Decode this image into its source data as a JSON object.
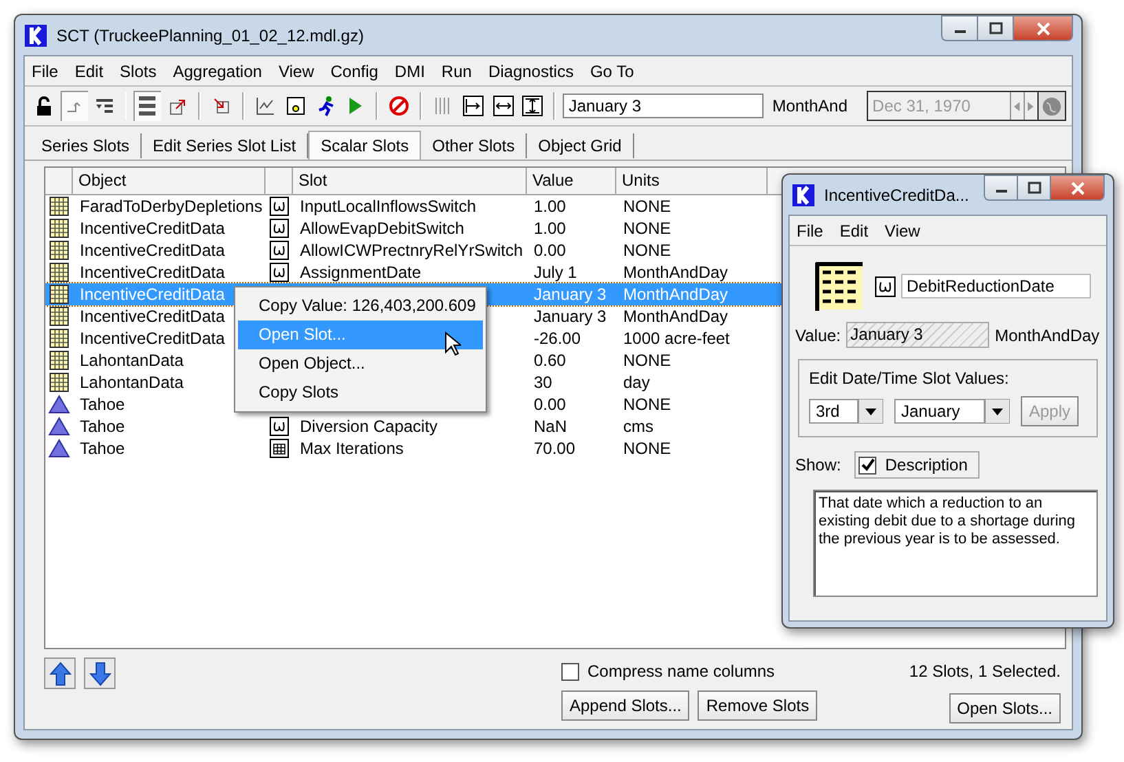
{
  "window": {
    "title": "SCT  (TruckeePlanning_01_02_12.mdl.gz)"
  },
  "menu": [
    "File",
    "Edit",
    "Slots",
    "Aggregation",
    "View",
    "Config",
    "DMI",
    "Run",
    "Diagnostics",
    "Go To"
  ],
  "toolbar": {
    "value": "January 3",
    "units": "MonthAnd",
    "date": {
      "value": "Dec 31, 1970",
      "disabled": true
    }
  },
  "tabs": [
    {
      "label": "Series Slots",
      "selected": false
    },
    {
      "label": "Edit Series Slot List",
      "selected": false
    },
    {
      "label": "Scalar Slots",
      "selected": true
    },
    {
      "label": "Other Slots",
      "selected": false
    },
    {
      "label": "Object Grid",
      "selected": false
    }
  ],
  "table": {
    "columns": [
      "Object",
      "Slot",
      "Value",
      "Units"
    ],
    "rows": [
      {
        "object": {
          "kind": "data",
          "name": "FaradToDerbyDepletions"
        },
        "slot": {
          "kind": "scalar",
          "name": "InputLocalInflowsSwitch"
        },
        "value": "1.00",
        "units": "NONE",
        "selected": false
      },
      {
        "object": {
          "kind": "data",
          "name": "IncentiveCreditData"
        },
        "slot": {
          "kind": "scalar",
          "name": "AllowEvapDebitSwitch"
        },
        "value": "1.00",
        "units": "NONE",
        "selected": false
      },
      {
        "object": {
          "kind": "data",
          "name": "IncentiveCreditData"
        },
        "slot": {
          "kind": "scalar",
          "name": "AllowICWPrectnryRelYrSwitch"
        },
        "value": "0.00",
        "units": "NONE",
        "selected": false
      },
      {
        "object": {
          "kind": "data",
          "name": "IncentiveCreditData"
        },
        "slot": {
          "kind": "scalar",
          "name": "AssignmentDate"
        },
        "value": "July 1",
        "units": "MonthAndDay",
        "selected": false
      },
      {
        "object": {
          "kind": "data",
          "name": "IncentiveCreditData"
        },
        "value": "January 3",
        "units": "MonthAndDay",
        "selected": true
      },
      {
        "object": {
          "kind": "data",
          "name": "IncentiveCreditData"
        },
        "value": "January 3",
        "units": "MonthAndDay",
        "selected": false
      },
      {
        "object": {
          "kind": "data",
          "name": "IncentiveCreditData"
        },
        "value": "-26.00",
        "units": "1000 acre-feet",
        "selected": false
      },
      {
        "object": {
          "kind": "data",
          "name": "LahontanData"
        },
        "value": "0.60",
        "units": "NONE",
        "selected": false
      },
      {
        "object": {
          "kind": "data",
          "name": "LahontanData"
        },
        "value": "30",
        "units": "day",
        "selected": false
      },
      {
        "object": {
          "kind": "reservoir",
          "name": "Tahoe"
        },
        "value": "0.00",
        "units": "NONE",
        "selected": false
      },
      {
        "object": {
          "kind": "reservoir",
          "name": "Tahoe"
        },
        "slot": {
          "kind": "scalar",
          "name": "Diversion Capacity"
        },
        "value": "NaN",
        "units": "cms",
        "selected": false
      },
      {
        "object": {
          "kind": "reservoir",
          "name": "Tahoe"
        },
        "slot": {
          "kind": "table",
          "name": "Max Iterations"
        },
        "value": "70.00",
        "units": "NONE",
        "selected": false
      }
    ]
  },
  "context_menu": [
    {
      "label": "Copy Value: 126,403,200.609",
      "selected": false
    },
    {
      "label": "Open Slot...",
      "selected": true
    },
    {
      "label": "Open Object...",
      "selected": false
    },
    {
      "label": "Copy Slots",
      "selected": false
    }
  ],
  "footer": {
    "compress": {
      "label": "Compress name columns",
      "checked": false
    },
    "status": "12 Slots, 1 Selected.",
    "buttons": [
      "Append Slots...",
      "Remove Slots"
    ],
    "open_button": "Open Slots..."
  },
  "slot_window": {
    "title": "IncentiveCreditDa...",
    "menu": [
      "File",
      "Edit",
      "View"
    ],
    "slot_name": "DebitReductionDate",
    "value_label": "Value:",
    "value": "January 3",
    "units": "MonthAndDay",
    "group_label": "Edit Date/Time Slot Values:",
    "day": "3rd",
    "month": "January",
    "apply": {
      "label": "Apply",
      "disabled": true
    },
    "show_label": "Show:",
    "description_toggle": {
      "label": "Description",
      "checked": true
    },
    "description": "That date which a reduction to an existing debit due to a shortage during the previous year is to be assessed."
  }
}
